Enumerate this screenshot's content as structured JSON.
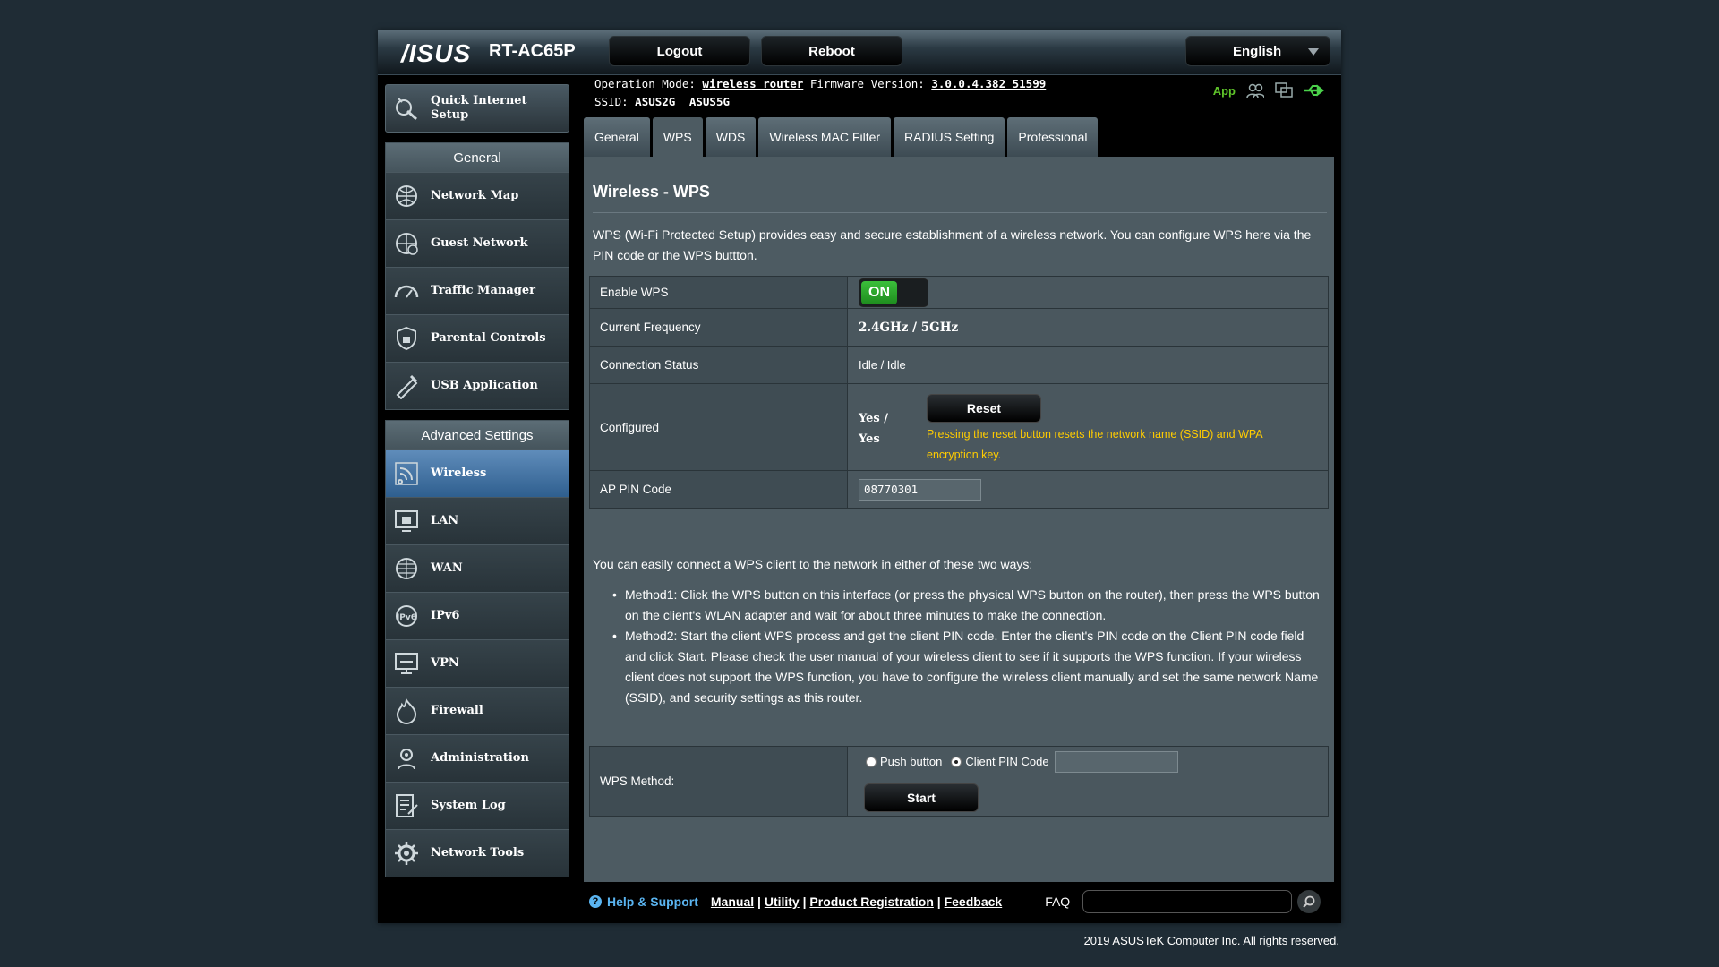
{
  "header": {
    "logo": "/ISUS",
    "model": "RT-AC65P",
    "logout_label": "Logout",
    "reboot_label": "Reboot",
    "language": "English",
    "app_label": "App"
  },
  "status": {
    "op_mode_label": "Operation Mode:",
    "op_mode_value": "wireless router",
    "firmware_label": "Firmware Version:",
    "firmware_value": "3.0.0.4.382_51599",
    "ssid_label": "SSID:",
    "ssid_1": "ASUS2G",
    "ssid_2": "ASUS5G"
  },
  "sidebar": {
    "qis_label_1": "Quick Internet",
    "qis_label_2": "Setup",
    "general_title": "General",
    "general_items": [
      {
        "label": "Network Map",
        "icon": "network-map-icon"
      },
      {
        "label": "Guest Network",
        "icon": "guest-network-icon"
      },
      {
        "label": "Traffic Manager",
        "icon": "traffic-manager-icon"
      },
      {
        "label": "Parental Controls",
        "icon": "parental-controls-icon"
      },
      {
        "label": "USB Application",
        "icon": "usb-application-icon"
      }
    ],
    "advanced_title": "Advanced Settings",
    "advanced_items": [
      {
        "label": "Wireless",
        "icon": "wireless-icon",
        "active": true
      },
      {
        "label": "LAN",
        "icon": "lan-icon"
      },
      {
        "label": "WAN",
        "icon": "wan-icon"
      },
      {
        "label": "IPv6",
        "icon": "ipv6-icon"
      },
      {
        "label": "VPN",
        "icon": "vpn-icon"
      },
      {
        "label": "Firewall",
        "icon": "firewall-icon"
      },
      {
        "label": "Administration",
        "icon": "administration-icon"
      },
      {
        "label": "System Log",
        "icon": "system-log-icon"
      },
      {
        "label": "Network Tools",
        "icon": "network-tools-icon"
      }
    ]
  },
  "tabs": [
    "General",
    "WPS",
    "WDS",
    "Wireless MAC Filter",
    "RADIUS Setting",
    "Professional"
  ],
  "active_tab": "WPS",
  "main": {
    "title": "Wireless - WPS",
    "description": "WPS (Wi-Fi Protected Setup) provides easy and secure establishment of a wireless network. You can configure WPS here via the PIN code or the WPS buttton.",
    "enable_wps_label": "Enable WPS",
    "enable_wps_value": "ON",
    "freq_label": "Current Frequency",
    "freq_value": "2.4GHz / 5GHz",
    "conn_label": "Connection Status",
    "conn_value": "Idle / Idle",
    "configured_label": "Configured",
    "configured_value_1": "Yes /",
    "configured_value_2": "Yes",
    "reset_label": "Reset",
    "reset_note": "Pressing the reset button resets the network name (SSID) and WPA encryption key.",
    "pin_label": "AP PIN Code",
    "pin_value": "08770301",
    "howto": "You can easily connect a WPS client to the network in either of these two ways:",
    "method1": "Method1: Click the WPS button on this interface (or press the physical WPS button on the router), then press the WPS button on the client's WLAN adapter and wait for about three minutes to make the connection.",
    "method2": "Method2: Start the client WPS process and get the client PIN code. Enter the client's PIN code on the Client PIN code field and click Start. Please check the user manual of your wireless client to see if it supports the WPS function. If your wireless client does not support the WPS function, you have to configure the wireless client manually and set the same network Name (SSID), and security settings as this router.",
    "method_label": "WPS Method:",
    "push_button_label": "Push button",
    "client_pin_label": "Client PIN Code",
    "client_pin_value": "",
    "start_label": "Start"
  },
  "footer": {
    "help_label": "Help & Support",
    "manual": "Manual",
    "utility": "Utility",
    "product_registration": "Product Registration",
    "feedback": "Feedback",
    "faq_label": "FAQ",
    "copyright": "2019 ASUSTeK Computer Inc. All rights reserved."
  },
  "colors": {
    "accent_yellow": "#ffcc00",
    "toggle_green": "#2aa52a",
    "active_nav": "#3f72a4"
  }
}
